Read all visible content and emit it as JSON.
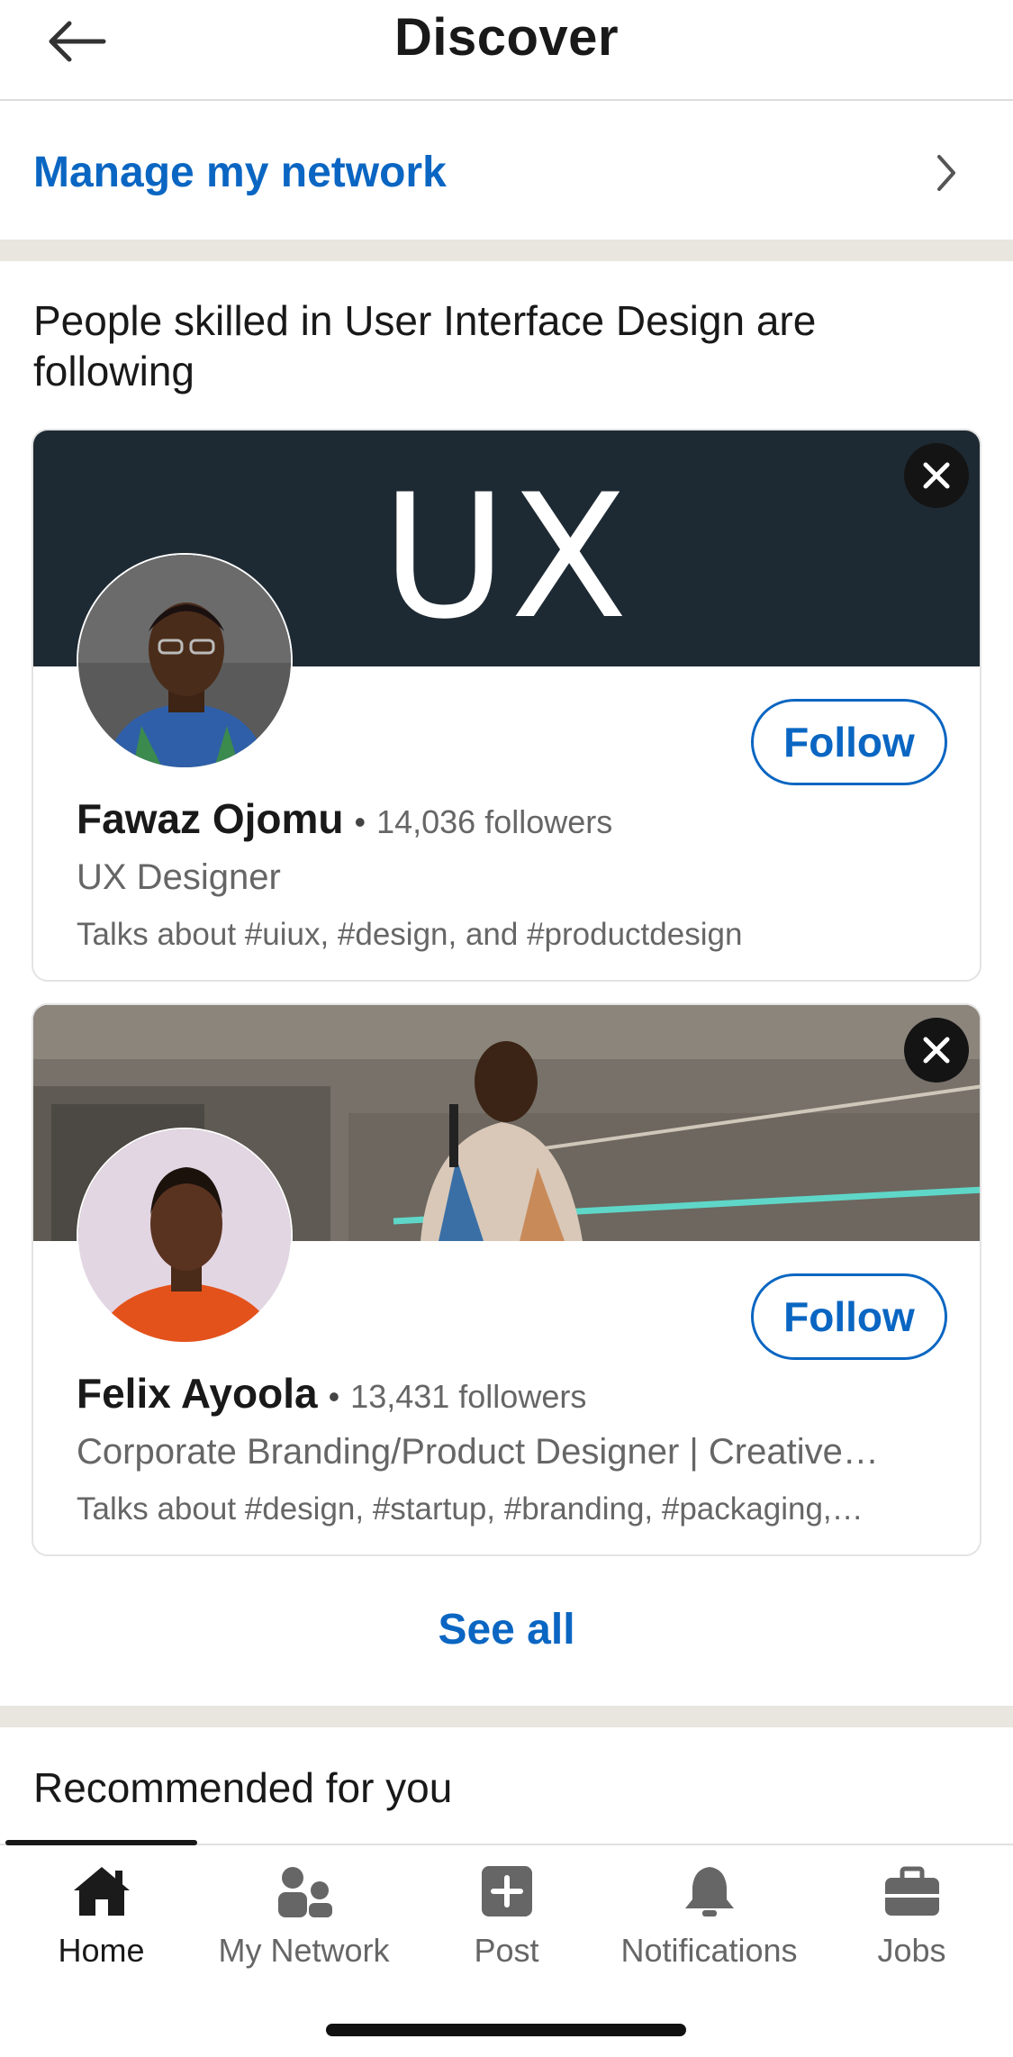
{
  "header": {
    "title": "Discover",
    "back_icon": "arrow-left-icon"
  },
  "manage": {
    "label": "Manage my network",
    "chevron_icon": "chevron-right-icon"
  },
  "section": {
    "heading": "People skilled in User Interface Design are following",
    "cards": [
      {
        "banner_text": "UX",
        "name": "Fawaz Ojomu",
        "separator": "•",
        "followers": "14,036 followers",
        "headline": "UX Designer",
        "talks": "Talks about #uiux, #design, and #productdesign",
        "follow_label": "Follow"
      },
      {
        "banner_text": "",
        "name": "Felix Ayoola",
        "separator": "•",
        "followers": "13,431 followers",
        "headline": "Corporate Branding/Product Designer | Creative…",
        "talks": "Talks about #design, #startup, #branding, #packaging,…",
        "follow_label": "Follow"
      }
    ],
    "see_all": "See all"
  },
  "recommended": {
    "heading": "Recommended for you"
  },
  "nav": {
    "items": [
      {
        "label": "Home",
        "icon": "home-icon",
        "active": true
      },
      {
        "label": "My Network",
        "icon": "people-icon",
        "active": false
      },
      {
        "label": "Post",
        "icon": "plus-square-icon",
        "active": false
      },
      {
        "label": "Notifications",
        "icon": "bell-icon",
        "active": false
      },
      {
        "label": "Jobs",
        "icon": "briefcase-icon",
        "active": false
      }
    ]
  },
  "colors": {
    "accent": "#0a66c2",
    "divider": "#e9e5df",
    "text": "#191919",
    "muted": "#666666"
  }
}
